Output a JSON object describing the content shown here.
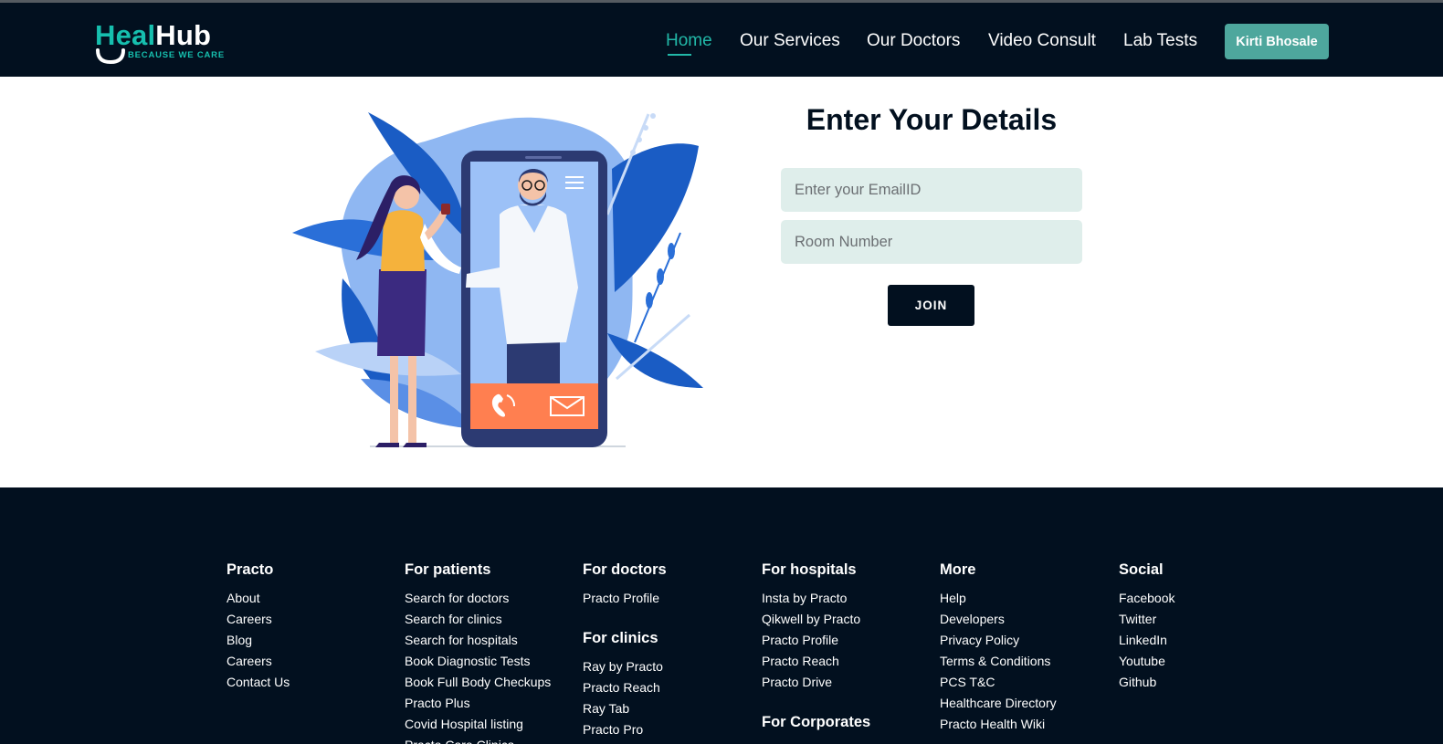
{
  "brand": {
    "name_part1": "Heal",
    "name_part2": "Hub",
    "tagline": "BECAUSE WE CARE",
    "primary_color": "#16bfae",
    "dark_color": "#02101f"
  },
  "nav": {
    "links": [
      "Home",
      "Our Services",
      "Our Doctors",
      "Video Consult",
      "Lab Tests"
    ],
    "active": "Home",
    "user_button": "Kirti Bhosale",
    "user_button_color": "#4ea79d"
  },
  "form": {
    "title": "Enter Your Details",
    "email_placeholder": "Enter your EmailID",
    "room_placeholder": "Room Number",
    "join_label": "JOIN",
    "field_bg_color": "#dfeeeb"
  },
  "footer": {
    "practo": {
      "heading": "Practo",
      "links": [
        "About",
        "Careers",
        "Blog",
        "Careers",
        "Contact Us"
      ]
    },
    "patients": {
      "heading": "For patients",
      "links": [
        "Search for doctors",
        "Search for clinics",
        "Search for hospitals",
        "Book Diagnostic Tests",
        "Book Full Body Checkups",
        "Practo Plus",
        "Covid Hospital listing",
        "Practo Care Clinics"
      ]
    },
    "doctors": {
      "heading": "For doctors",
      "links": [
        "Practo Profile"
      ]
    },
    "clinics": {
      "heading": "For clinics",
      "links": [
        "Ray by Practo",
        "Practo Reach",
        "Ray Tab",
        "Practo Pro"
      ]
    },
    "hospitals": {
      "heading": "For hospitals",
      "links": [
        "Insta by Practo",
        "Qikwell by Practo",
        "Practo Profile",
        "Practo Reach",
        "Practo Drive"
      ]
    },
    "corporates": {
      "heading": "For Corporates"
    },
    "more": {
      "heading": "More",
      "links": [
        "Help",
        "Developers",
        "Privacy Policy",
        "Terms & Conditions",
        "PCS T&C",
        "Healthcare Directory",
        "Practo Health Wiki"
      ]
    },
    "social": {
      "heading": "Social",
      "links": [
        "Facebook",
        "Twitter",
        "LinkedIn",
        "Youtube",
        "Github"
      ]
    }
  }
}
